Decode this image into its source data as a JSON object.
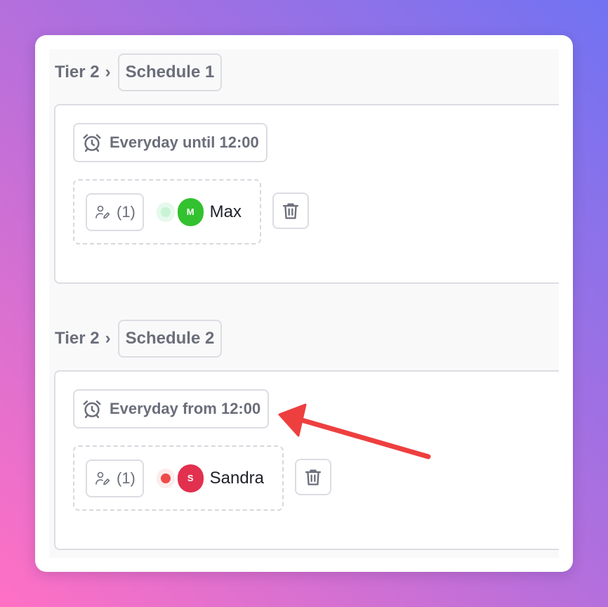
{
  "schedules": [
    {
      "tier": "Tier 2",
      "separator": "›",
      "name": "Schedule 1",
      "rule": "Everyday until 12:00",
      "count": "(1)",
      "member": {
        "initial": "M",
        "name": "Max",
        "avatar_color": "#33c12f",
        "status_color": "#c8f3d4",
        "status_ring": "#e6f9ec"
      }
    },
    {
      "tier": "Tier 2",
      "separator": "›",
      "name": "Schedule 2",
      "rule": "Everyday from 12:00",
      "count": "(1)",
      "member": {
        "initial": "S",
        "name": "Sandra",
        "avatar_color": "#e2304f",
        "status_color": "#ee4b4b",
        "status_ring": "#fdecec"
      }
    }
  ],
  "icons": {
    "alarm": "alarm-clock-icon",
    "users": "user-edit-icon",
    "trash": "trash-icon",
    "annotation": "red-arrow"
  },
  "colors": {
    "annotation_arrow": "#ee3f3f",
    "text_muted": "#6b6e7a",
    "border": "#dcdde3"
  }
}
